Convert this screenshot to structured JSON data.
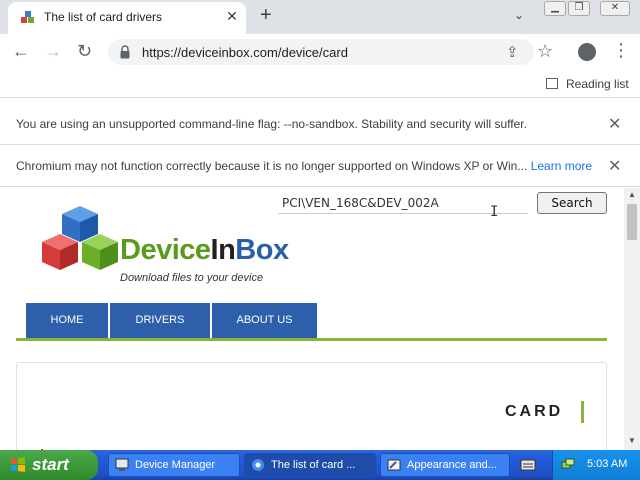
{
  "browser": {
    "tab_title": "The list of card drivers",
    "url": "https://deviceinbox.com/device/card",
    "reading_list_label": "Reading list"
  },
  "infobars": [
    {
      "text": "You are using an unsupported command-line flag: --no-sandbox. Stability and security will suffer.",
      "link": ""
    },
    {
      "text": "Chromium may not function correctly because it is no longer supported on Windows XP or Win...",
      "link": "Learn more"
    }
  ],
  "page": {
    "search_value": "PCI\\VEN_168C&DEV_002A",
    "search_button": "Search",
    "logo": {
      "part1": "Device",
      "part2": "In",
      "part3": "Box"
    },
    "tagline": "Download files to your device",
    "nav": [
      "HOME",
      "DRIVERS",
      "ABOUT US"
    ],
    "heading": "CARD"
  },
  "taskbar": {
    "start_label": "start",
    "tasks": [
      "Device Manager",
      "The list of card ...",
      "Appearance and..."
    ],
    "clock": "5:03 AM"
  },
  "colors": {
    "nav_blue": "#2d5faa",
    "accent_green": "#8ab43a",
    "logo_green": "#5a9a1c",
    "logo_blue": "#2b5fa8",
    "link_blue": "#1a73e8"
  }
}
